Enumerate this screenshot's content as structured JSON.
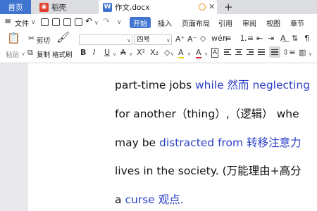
{
  "tabs": {
    "home": "首页",
    "draft": "稻壳",
    "doc": "作文.docx"
  },
  "menu": {
    "file": "文件",
    "start": "开始",
    "insert": "插入",
    "layout": "页面布局",
    "reference": "引用",
    "review": "审阅",
    "view": "视图",
    "section": "章节"
  },
  "ribbon": {
    "paste": "粘贴",
    "cut": "剪切",
    "copy": "复制",
    "format_painter": "格式刷",
    "font_size": "四号",
    "bold": "B",
    "italic": "I",
    "underline": "U",
    "font_color_a": "A",
    "superscript": "X²",
    "subscript": "X₂",
    "clear_format": "◇",
    "highlight": "A",
    "color_a": "A",
    "border": "A"
  },
  "document": {
    "lines": [
      {
        "parts": [
          [
            "part-time jobs ",
            ""
          ],
          [
            "while ",
            "blue"
          ],
          [
            "然而 ",
            "blue cn"
          ],
          [
            "neglecting",
            "blue"
          ]
        ]
      },
      {
        "parts": [
          [
            "for another（thing）,（",
            ""
          ],
          [
            "逻辑",
            "cn"
          ],
          [
            "）  whe",
            ""
          ]
        ]
      },
      {
        "parts": [
          [
            "may be ",
            ""
          ],
          [
            "distracted from ",
            "blue"
          ],
          [
            "转移注意力",
            "blue cn"
          ]
        ]
      },
      {
        "parts": [
          [
            "lives in the society. (",
            ""
          ],
          [
            "万能理由+高分",
            "cn"
          ]
        ]
      },
      {
        "parts": [
          [
            "a ",
            ""
          ],
          [
            "curse ",
            "blue"
          ],
          [
            "观点.",
            "blue cn"
          ]
        ]
      }
    ]
  },
  "colors": {
    "accent": "#3f75d0",
    "blue_text": "#2a3fc6",
    "tab_bar": "#dcdde1",
    "doc_bg": "#e9e9ec"
  }
}
